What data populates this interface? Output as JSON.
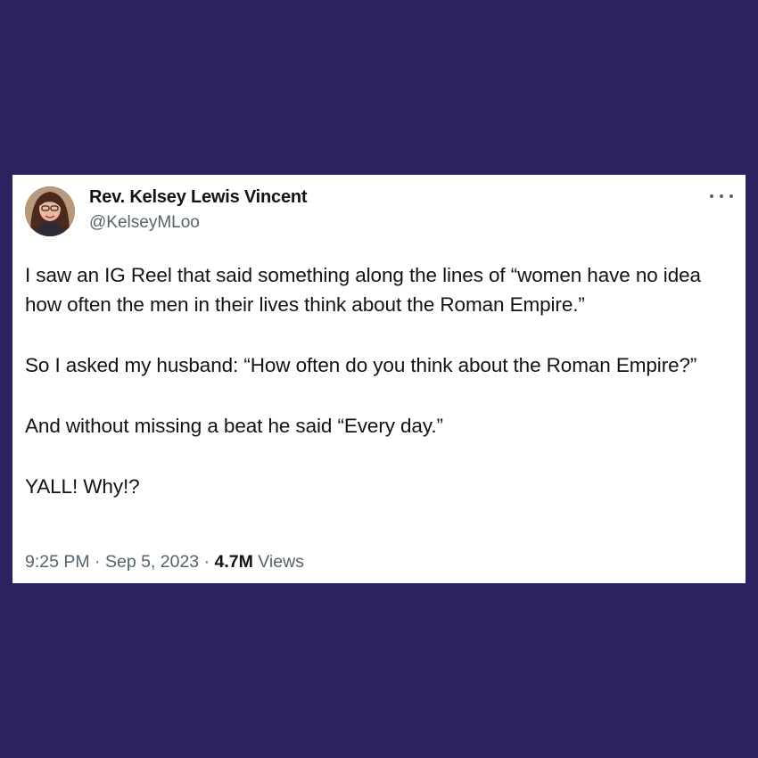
{
  "tweet": {
    "display_name": "Rev. Kelsey Lewis Vincent",
    "handle": "@KelseyMLoo",
    "paragraphs": [
      "I saw an IG Reel that said something along the lines of “women have no idea how often the men in their lives think about the Roman Empire.”",
      "So I asked my husband: “How often do you think about the Roman Empire?”",
      "And without missing a beat he said “Every day.”",
      "YALL! Why!?"
    ],
    "time": "9:25 PM",
    "separator": "·",
    "date": "Sep 5, 2023",
    "views_count": "4.7M",
    "views_label": "Views"
  },
  "colors": {
    "background": "#2b2260",
    "card": "#ffffff",
    "text_primary": "#0f1419",
    "text_secondary": "#536471"
  },
  "icons": {
    "more": "more-options-icon",
    "avatar": "profile-avatar"
  }
}
